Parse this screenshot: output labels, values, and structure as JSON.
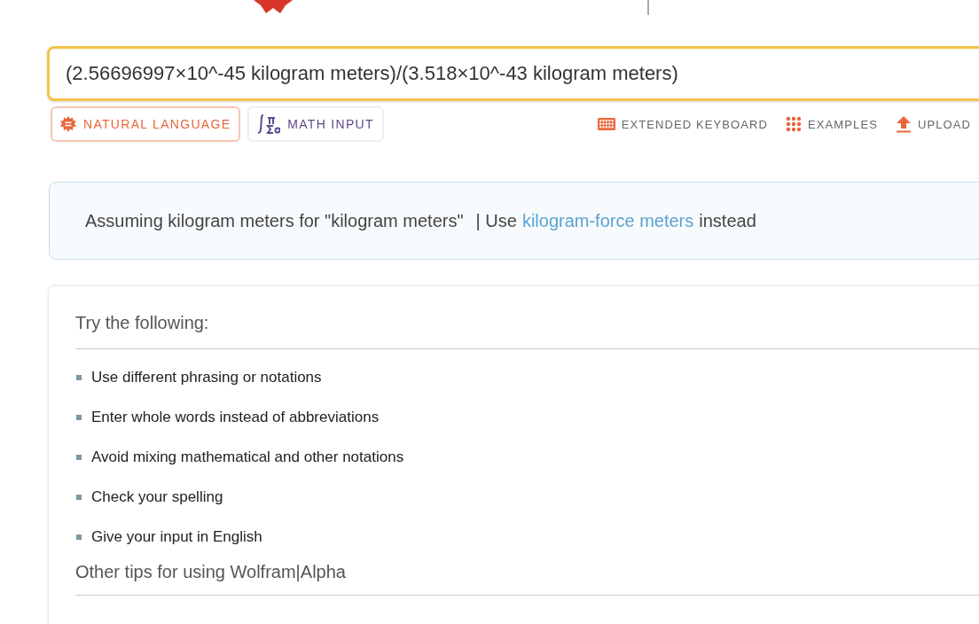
{
  "search": {
    "value": "(2.56696997×10^-45 kilogram meters)/(3.518×10^-43 kilogram meters)"
  },
  "modes": [
    {
      "label": "NATURAL LANGUAGE",
      "kind": "natural",
      "selected": true
    },
    {
      "label": "MATH INPUT",
      "kind": "math",
      "selected": false
    }
  ],
  "tools": [
    {
      "label": "EXTENDED KEYBOARD",
      "kind": "keyboard"
    },
    {
      "label": "EXAMPLES",
      "kind": "examples"
    },
    {
      "label": "UPLOAD",
      "kind": "upload"
    }
  ],
  "assumption": {
    "text": "Assuming kilogram meters for \"kilogram meters\"",
    "use": "| Use",
    "link": "kilogram-force meters",
    "after": "instead"
  },
  "tips": {
    "title": "Try the following:",
    "items": [
      "Use different phrasing or notations",
      "Enter whole words instead of abbreviations",
      "Avoid mixing mathematical and other notations",
      "Check your spelling",
      "Give your input in English"
    ],
    "other": "Other tips for using Wolfram|Alpha"
  }
}
